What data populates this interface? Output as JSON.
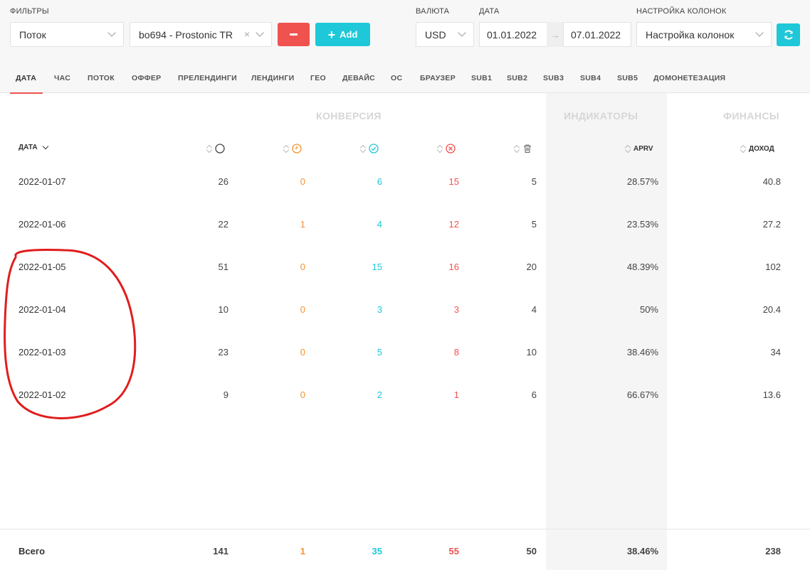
{
  "filters": {
    "label": "ФИЛЬТРЫ",
    "stream_select": "Поток",
    "offer_select": "bo694 - Prostonic TR",
    "offer_clear": "×",
    "add_label": "Add"
  },
  "currency": {
    "label": "ВАЛЮТА",
    "value": "USD"
  },
  "date": {
    "label": "ДАТА",
    "from": "01.01.2022",
    "arrow": "→",
    "to": "07.01.2022"
  },
  "columns_setup": {
    "label": "НАСТРОЙКА КОЛОНОК",
    "value": "Настройка колонок"
  },
  "tabs": [
    {
      "label": "ДАТА"
    },
    {
      "label": "ЧАС"
    },
    {
      "label": "ПОТОК"
    },
    {
      "label": "ОФФЕР"
    },
    {
      "label": "ПРЕЛЕНДИНГИ"
    },
    {
      "label": "ЛЕНДИНГИ"
    },
    {
      "label": "ГЕО"
    },
    {
      "label": "ДЕВАЙС"
    },
    {
      "label": "ОС"
    },
    {
      "label": "БРАУЗЕР"
    },
    {
      "label": "SUB1"
    },
    {
      "label": "SUB2"
    },
    {
      "label": "SUB3"
    },
    {
      "label": "SUB4"
    },
    {
      "label": "SUB5"
    },
    {
      "label": "ДОМОНЕТЕЗАЦИЯ"
    }
  ],
  "groups": {
    "conversion": "КОНВЕРСИЯ",
    "indicators": "ИНДИКАТОРЫ",
    "finance": "ФИНАНСЫ"
  },
  "headers": {
    "date": "ДАТА",
    "aprv": "APRV",
    "income": "ДОХОД"
  },
  "colors": {
    "accent": "#1ec8d8",
    "danger": "#f0524f",
    "warning": "#f5922c"
  },
  "icons": [
    "circle-icon",
    "clock-icon",
    "check-circle-icon",
    "x-circle-icon",
    "trash-icon",
    "refresh-icon"
  ],
  "rows": [
    {
      "date": "2022-01-07",
      "total": "26",
      "hold": "0",
      "approved": "6",
      "rejected": "15",
      "trash": "5",
      "aprv": "28.57%",
      "income": "40.8"
    },
    {
      "date": "2022-01-06",
      "total": "22",
      "hold": "1",
      "approved": "4",
      "rejected": "12",
      "trash": "5",
      "aprv": "23.53%",
      "income": "27.2"
    },
    {
      "date": "2022-01-05",
      "total": "51",
      "hold": "0",
      "approved": "15",
      "rejected": "16",
      "trash": "20",
      "aprv": "48.39%",
      "income": "102"
    },
    {
      "date": "2022-01-04",
      "total": "10",
      "hold": "0",
      "approved": "3",
      "rejected": "3",
      "trash": "4",
      "aprv": "50%",
      "income": "20.4"
    },
    {
      "date": "2022-01-03",
      "total": "23",
      "hold": "0",
      "approved": "5",
      "rejected": "8",
      "trash": "10",
      "aprv": "38.46%",
      "income": "34"
    },
    {
      "date": "2022-01-02",
      "total": "9",
      "hold": "0",
      "approved": "2",
      "rejected": "1",
      "trash": "6",
      "aprv": "66.67%",
      "income": "13.6"
    }
  ],
  "totals": {
    "label": "Всего",
    "total": "141",
    "hold": "1",
    "approved": "35",
    "rejected": "55",
    "trash": "50",
    "aprv": "38.46%",
    "income": "238"
  }
}
